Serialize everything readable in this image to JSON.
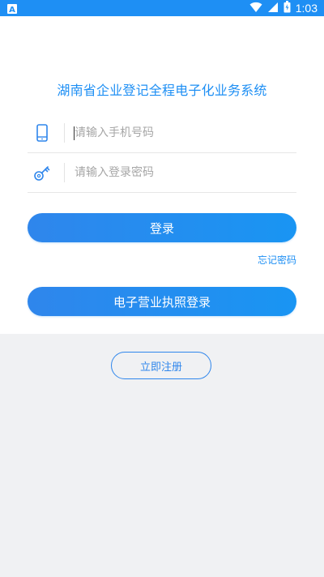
{
  "status_bar": {
    "time": "1:03",
    "left_icon": "a-notification-icon",
    "right_icons": [
      "wifi-icon",
      "signal-icon",
      "battery-icon"
    ],
    "color": "#1e8ff4"
  },
  "title": "湖南省企业登记全程电子化业务系统",
  "phone_input": {
    "placeholder": "请输入手机号码",
    "value": "",
    "icon": "phone-icon"
  },
  "password_input": {
    "placeholder": "请输入登录密码",
    "value": "",
    "icon": "key-icon"
  },
  "login_button": {
    "label": "登录"
  },
  "forgot_password": {
    "label": "忘记密码"
  },
  "license_login_button": {
    "label": "电子营业执照登录"
  },
  "register_button": {
    "label": "立即注册"
  },
  "colors": {
    "accent": "#1e8ff4",
    "background": "#f0f1f3",
    "card": "#ffffff"
  }
}
